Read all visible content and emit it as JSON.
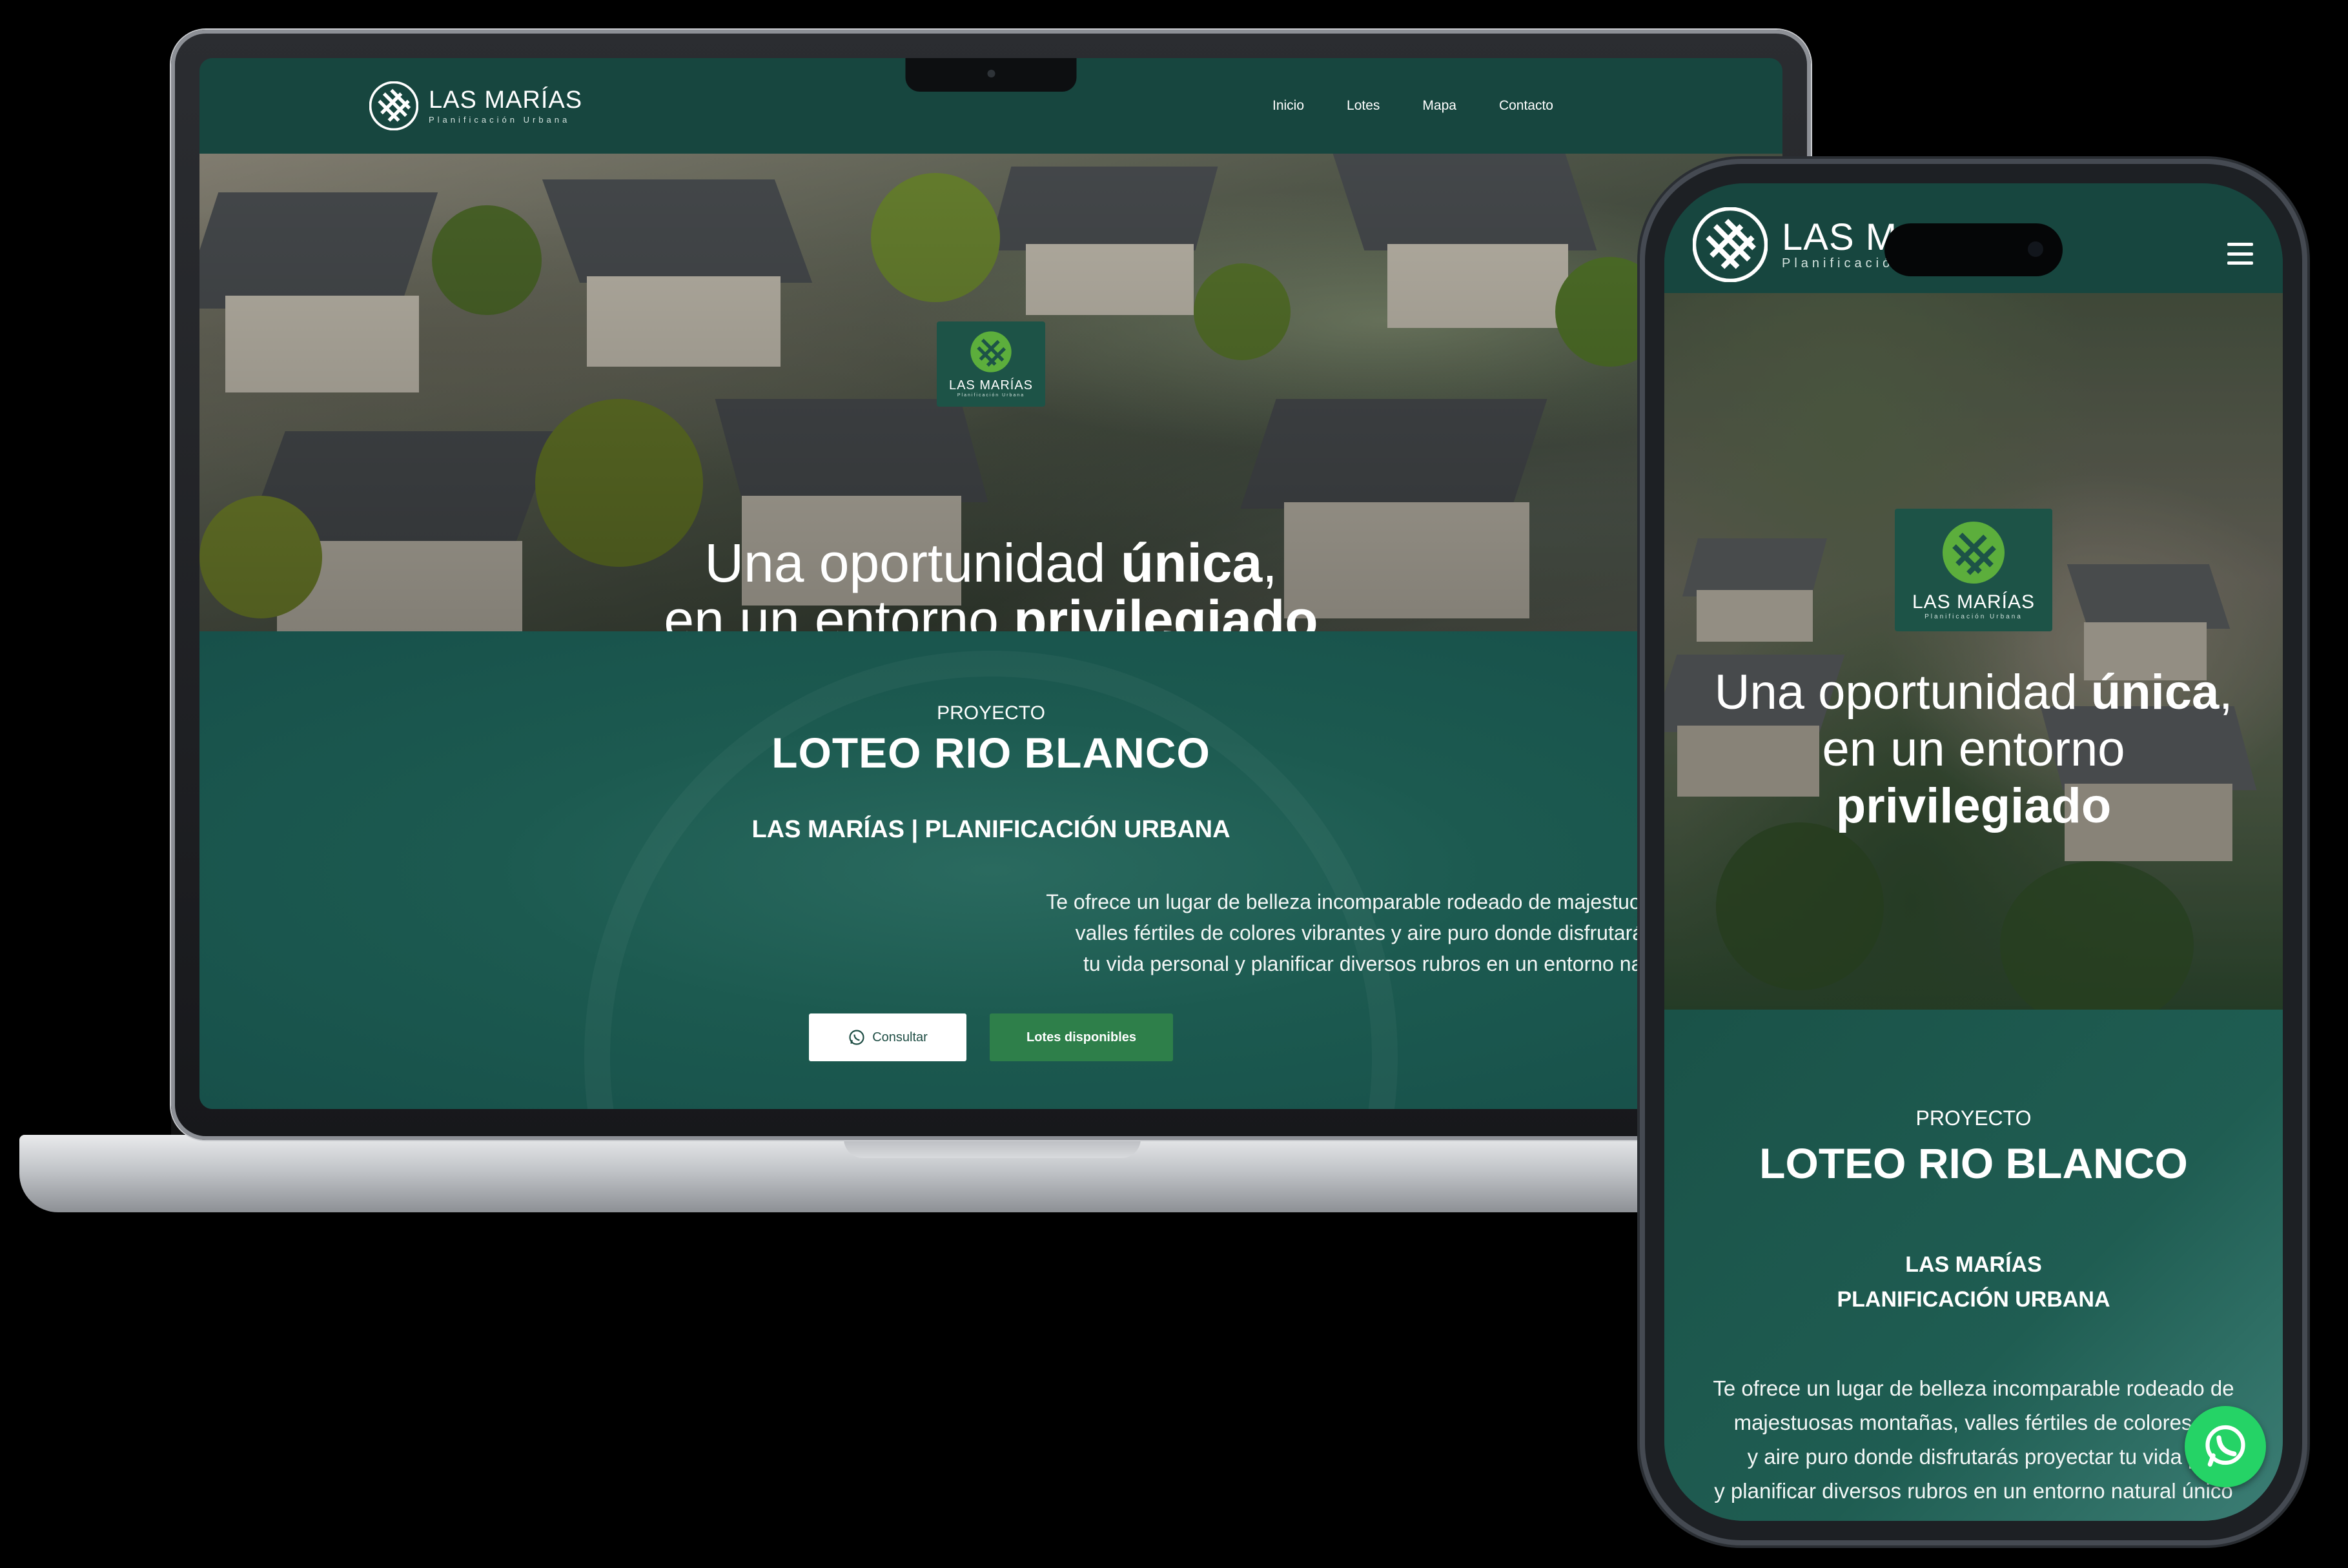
{
  "brand": {
    "name": "LAS MARÍAS",
    "tagline": "Planificación Urbana",
    "phone_name_visible": "LAS M",
    "badge_name": "LAS MARÍAS"
  },
  "nav": {
    "items": [
      {
        "label": "Inicio"
      },
      {
        "label": "Lotes"
      },
      {
        "label": "Mapa"
      },
      {
        "label": "Contacto"
      }
    ]
  },
  "hero": {
    "line1_light": "Una oportunidad ",
    "line1_bold": "única",
    "line1_tail": ",",
    "line2_light": "en un entorno ",
    "line2_bold": "privilegiado"
  },
  "project": {
    "kicker": "PROYECTO",
    "title": "LOTEO RIO BLANCO",
    "subtitle": "LAS MARÍAS | PLANIFICACIÓN URBANA",
    "subtitle_line1": "LAS MARÍAS",
    "subtitle_line2": "PLANIFICACIÓN URBANA",
    "description_laptop": [
      "Te ofrece un lugar de belleza incomparable rodeado de majestuosas montañas,",
      "valles fértiles de colores vibrantes y aire puro donde disfrutarás proyectar",
      "tu vida personal y planificar diversos rubros en un entorno natural único"
    ],
    "description_phone": [
      "Te ofrece un lugar de belleza incomparable rodeado de",
      "majestuosas montañas, valles fértiles de colores vi",
      "y aire puro donde disfrutarás proyectar tu vida p",
      "y planificar diversos rubros en un entorno natural único"
    ]
  },
  "buttons": {
    "consult": "Consultar",
    "lots": "Lotes disponibles"
  },
  "colors": {
    "brand_dark_green": "#17463f",
    "section_green": "#1c5a50",
    "button_green": "#2e7f4a",
    "logo_green": "#5cae3c",
    "whatsapp": "#25d366"
  },
  "icons": {
    "logo": "woven-x-logo-icon",
    "whatsapp": "whatsapp-icon",
    "menu": "hamburger-menu-icon"
  }
}
